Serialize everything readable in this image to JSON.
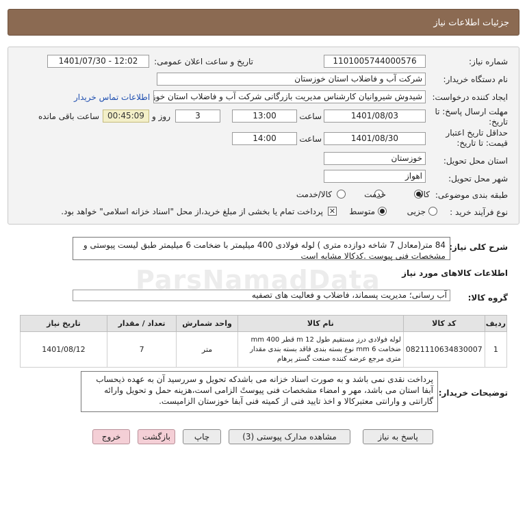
{
  "header": {
    "title": "جزئیات اطلاعات نیاز"
  },
  "form": {
    "need_number_label": "شماره نیاز:",
    "need_number": "1101005744000576",
    "announce_label": "تاریخ و ساعت اعلان عمومی:",
    "announce_value": "1401/07/30 - 12:02",
    "buyer_org_label": "نام دستگاه خریدار:",
    "buyer_org": "شرکت آب و فاضلاب استان خوزستان",
    "requester_label": "ایجاد کننده درخواست:",
    "requester": "شیدوش شیروانیان کارشناس مدیریت بازرگانی شرکت آب و فاضلاب استان خوزستان",
    "contact_link": "اطلاعات تماس خریدار",
    "reply_deadline_label_1": "مهلت ارسال پاسخ: تا",
    "reply_deadline_label_2": "تاریخ:",
    "reply_date": "1401/08/03",
    "time_label": "ساعت",
    "reply_time": "13:00",
    "days_value": "3",
    "days_label": "روز و",
    "remaining_time": "00:45:09",
    "remaining_label": "ساعت باقی مانده",
    "validity_label_1": "حداقل تاریخ اعتبار",
    "validity_label_2": "قیمت: تا تاریخ:",
    "validity_date": "1401/08/30",
    "validity_time": "14:00",
    "province_label": "استان محل تحویل:",
    "province": "خوزستان",
    "city_label": "شهر محل تحویل:",
    "city": "اهواز",
    "category_label": "طبقه بندی موضوعی:",
    "category_options": [
      "کالا",
      "خدمت",
      "کالا/خدمت"
    ],
    "process_label": "نوع فرآیند خرید :",
    "process_options": [
      "جزیی",
      "متوسط"
    ],
    "payment_note": "پرداخت تمام یا بخشی از مبلغ خرید،از محل \"اسناد خزانه اسلامی\" خواهد بود."
  },
  "summary": {
    "label": "شرح کلی نیاز:",
    "text": "84 متر(معادل 7 شاخه دوازده متری ) لوله فولادی 400 میلیمتر با ضخامت 6 میلیمتر طبق لیست پیوستی و مشخصات فنی پیوست .کدکالا مشابه است"
  },
  "goods": {
    "section_title": "اطلاعات کالاهای مورد نیاز",
    "group_label": "گروه کالا:",
    "group_value": "آب رسانی؛ مدیریت پسماند، فاضلاب و فعالیت های تصفیه",
    "columns": [
      "ردیف",
      "کد کالا",
      "نام کالا",
      "واحد شمارش",
      "تعداد / مقدار",
      "تاریخ نیاز"
    ],
    "rows": [
      {
        "index": "1",
        "code": "0821110634830007",
        "name": "لوله فولادی درز مستقیم طول m 12 قطر mm 400 ضخامت 6 mm نوع بسته بندی فاقد بسته بندی مقدار متری مرجع عرضه کننده صنعت گستر پرهام",
        "unit": "متر",
        "quantity": "7",
        "date": "1401/08/12"
      }
    ]
  },
  "buyer_notes": {
    "label": "توضیحات خریدار:",
    "text": "پرداخت نقدی نمی باشد و به صورت اسناد خزانه می باشدکه تحویل و سررسید آن به عهده ذیحساب آبفا استان می باشد، مهر و امضاء مشخصات فنی پیوستً الزامی است،هزینه حمل و تحویل وارائه گارانتی و وارانتی معتبرکالا و اخذ تایید فنی از کمیته فنی آبفا خوزستان الزامیست."
  },
  "buttons": {
    "reply": "پاسخ به نیاز",
    "attachments": "مشاهده مدارک پیوستی (3)",
    "print": "چاپ",
    "back": "بازگشت",
    "exit": "خروج"
  },
  "watermark": "ParsNamadData"
}
